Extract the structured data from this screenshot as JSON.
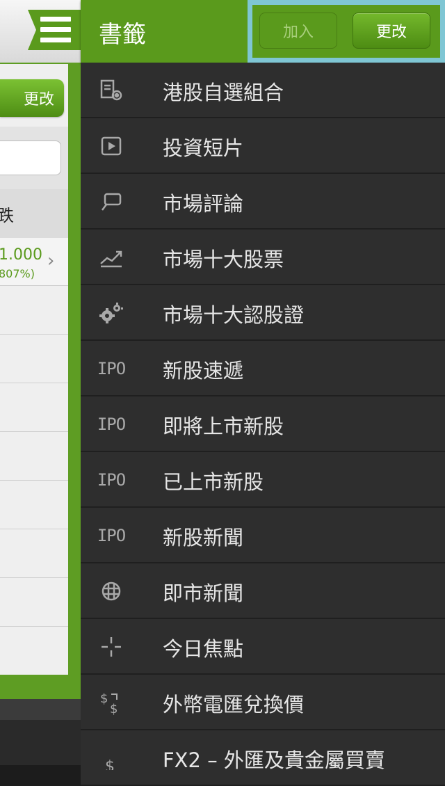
{
  "background": {
    "edit_label": "更改",
    "column_header": "跌",
    "price": "1.000",
    "percent": "807%)",
    "chevron": "›"
  },
  "drawer": {
    "title": "書籤",
    "add_label": "加入",
    "edit_label": "更改"
  },
  "menu": [
    {
      "label": "港股自選組合",
      "icon": "portfolio-icon"
    },
    {
      "label": "投資短片",
      "icon": "video-icon"
    },
    {
      "label": "市場評論",
      "icon": "comment-icon"
    },
    {
      "label": "市場十大股票",
      "icon": "trend-up-icon"
    },
    {
      "label": "市場十大認股證",
      "icon": "gears-icon"
    },
    {
      "label": "新股速遞",
      "icon": "ipo-icon",
      "icon_text": "IPO"
    },
    {
      "label": "即將上市新股",
      "icon": "ipo-icon",
      "icon_text": "IPO"
    },
    {
      "label": "已上市新股",
      "icon": "ipo-icon",
      "icon_text": "IPO"
    },
    {
      "label": "新股新聞",
      "icon": "ipo-icon",
      "icon_text": "IPO"
    },
    {
      "label": "即市新聞",
      "icon": "globe-icon"
    },
    {
      "label": "今日焦點",
      "icon": "crosshair-icon"
    },
    {
      "label": "外幣電匯兌換價",
      "icon": "currency-exchange-icon"
    },
    {
      "label": "FX2 – 外匯及貴金屬買賣",
      "icon": "dollar-icon"
    }
  ]
}
